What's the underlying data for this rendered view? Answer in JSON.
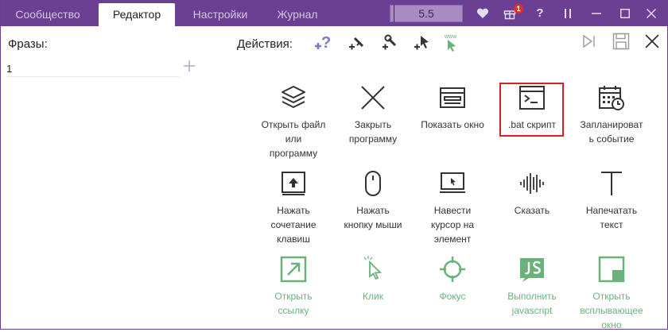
{
  "tabs": [
    "Сообщество",
    "Редактор",
    "Настройки",
    "Журнал"
  ],
  "active_tab": "Редактор",
  "version": "5.5",
  "notification_count": "1",
  "titlebar_icons": [
    "heart-icon",
    "gift-icon",
    "help-icon",
    "pause-icon",
    "minimize-icon",
    "maximize-icon",
    "close-icon"
  ],
  "phrases": {
    "label": "Фразы:",
    "items": [
      "1"
    ]
  },
  "actions_label": "Действия:",
  "action_icons": [
    "question-add-icon",
    "sword-add-icon",
    "wrench-add-icon",
    "cursor-add-icon",
    "web-cursor-icon"
  ],
  "editor_icons": [
    "run-icon",
    "save-icon",
    "close-editor-icon"
  ],
  "grid": [
    {
      "icon": "layers-icon",
      "label": "Открыть файл\nили\nпрограмму",
      "green": false
    },
    {
      "icon": "x-icon",
      "label": "Закрыть\nпрограмму",
      "green": false
    },
    {
      "icon": "window-icon",
      "label": "Показать окно",
      "green": false
    },
    {
      "icon": "terminal-icon",
      "label": ".bat скрипт",
      "green": false
    },
    {
      "icon": "calendar-icon",
      "label": "Запланироват\nь событие",
      "green": false
    },
    {
      "icon": "keyboard-key-icon",
      "label": "Нажать\nсочетание\nклавиш",
      "green": false
    },
    {
      "icon": "mouse-icon",
      "label": "Нажать\nкнопку мыши",
      "green": false
    },
    {
      "icon": "hover-cursor-icon",
      "label": "Навести\nкурсор на\nэлемент",
      "green": false
    },
    {
      "icon": "sound-wave-icon",
      "label": "Сказать",
      "green": false
    },
    {
      "icon": "text-t-icon",
      "label": "Напечатать\nтекст",
      "green": false
    },
    {
      "icon": "open-link-icon",
      "label": "Открыть\nссылку",
      "green": true
    },
    {
      "icon": "click-icon",
      "label": "Клик",
      "green": true
    },
    {
      "icon": "focus-icon",
      "label": "Фокус",
      "green": true
    },
    {
      "icon": "js-icon",
      "label": "Выполнить\njavascript",
      "green": true
    },
    {
      "icon": "popup-icon",
      "label": "Открыть\nвсплывающее\nокно",
      "green": true
    }
  ],
  "colors": {
    "titlebar": "#6b3f91",
    "green": "#6ab27a",
    "action_blue": "#7a7ac8",
    "highlight": "#d9202a"
  }
}
